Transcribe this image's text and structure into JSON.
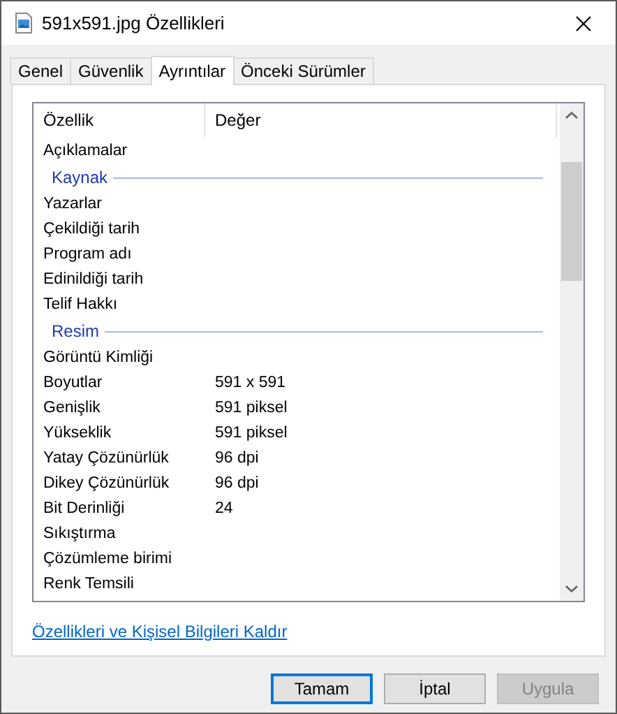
{
  "window": {
    "title": "591x591.jpg Özellikleri"
  },
  "tabs": [
    {
      "label": "Genel",
      "selected": false
    },
    {
      "label": "Güvenlik",
      "selected": false
    },
    {
      "label": "Ayrıntılar",
      "selected": true
    },
    {
      "label": "Önceki Sürümler",
      "selected": false
    }
  ],
  "table": {
    "columns": [
      "Özellik",
      "Değer"
    ],
    "rows": [
      {
        "kind": "row",
        "name": "Açıklamalar"
      },
      {
        "kind": "group",
        "name": "Kaynak"
      },
      {
        "kind": "row",
        "name": "Yazarlar"
      },
      {
        "kind": "row",
        "name": "Çekildiği tarih"
      },
      {
        "kind": "row",
        "name": "Program adı"
      },
      {
        "kind": "row",
        "name": "Edinildiği tarih"
      },
      {
        "kind": "row",
        "name": "Telif Hakkı"
      },
      {
        "kind": "group",
        "name": "Resim"
      },
      {
        "kind": "row",
        "name": "Görüntü Kimliği"
      },
      {
        "kind": "row",
        "name": "Boyutlar",
        "value": "591 x 591"
      },
      {
        "kind": "row",
        "name": "Genişlik",
        "value": "591 piksel"
      },
      {
        "kind": "row",
        "name": "Yükseklik",
        "value": "591 piksel"
      },
      {
        "kind": "row",
        "name": "Yatay Çözünürlük",
        "value": "96 dpi"
      },
      {
        "kind": "row",
        "name": "Dikey Çözünürlük",
        "value": "96 dpi"
      },
      {
        "kind": "row",
        "name": "Bit Derinliği",
        "value": "24"
      },
      {
        "kind": "row",
        "name": "Sıkıştırma"
      },
      {
        "kind": "row",
        "name": "Çözümleme birimi"
      },
      {
        "kind": "row",
        "name": "Renk Temsili"
      }
    ]
  },
  "link": "Özellikleri ve Kişisel Bilgileri Kaldır",
  "buttons": [
    {
      "label": "Tamam",
      "focused": true,
      "disabled": false
    },
    {
      "label": "İptal",
      "focused": false,
      "disabled": false
    },
    {
      "label": "Uygula",
      "focused": false,
      "disabled": true
    }
  ]
}
